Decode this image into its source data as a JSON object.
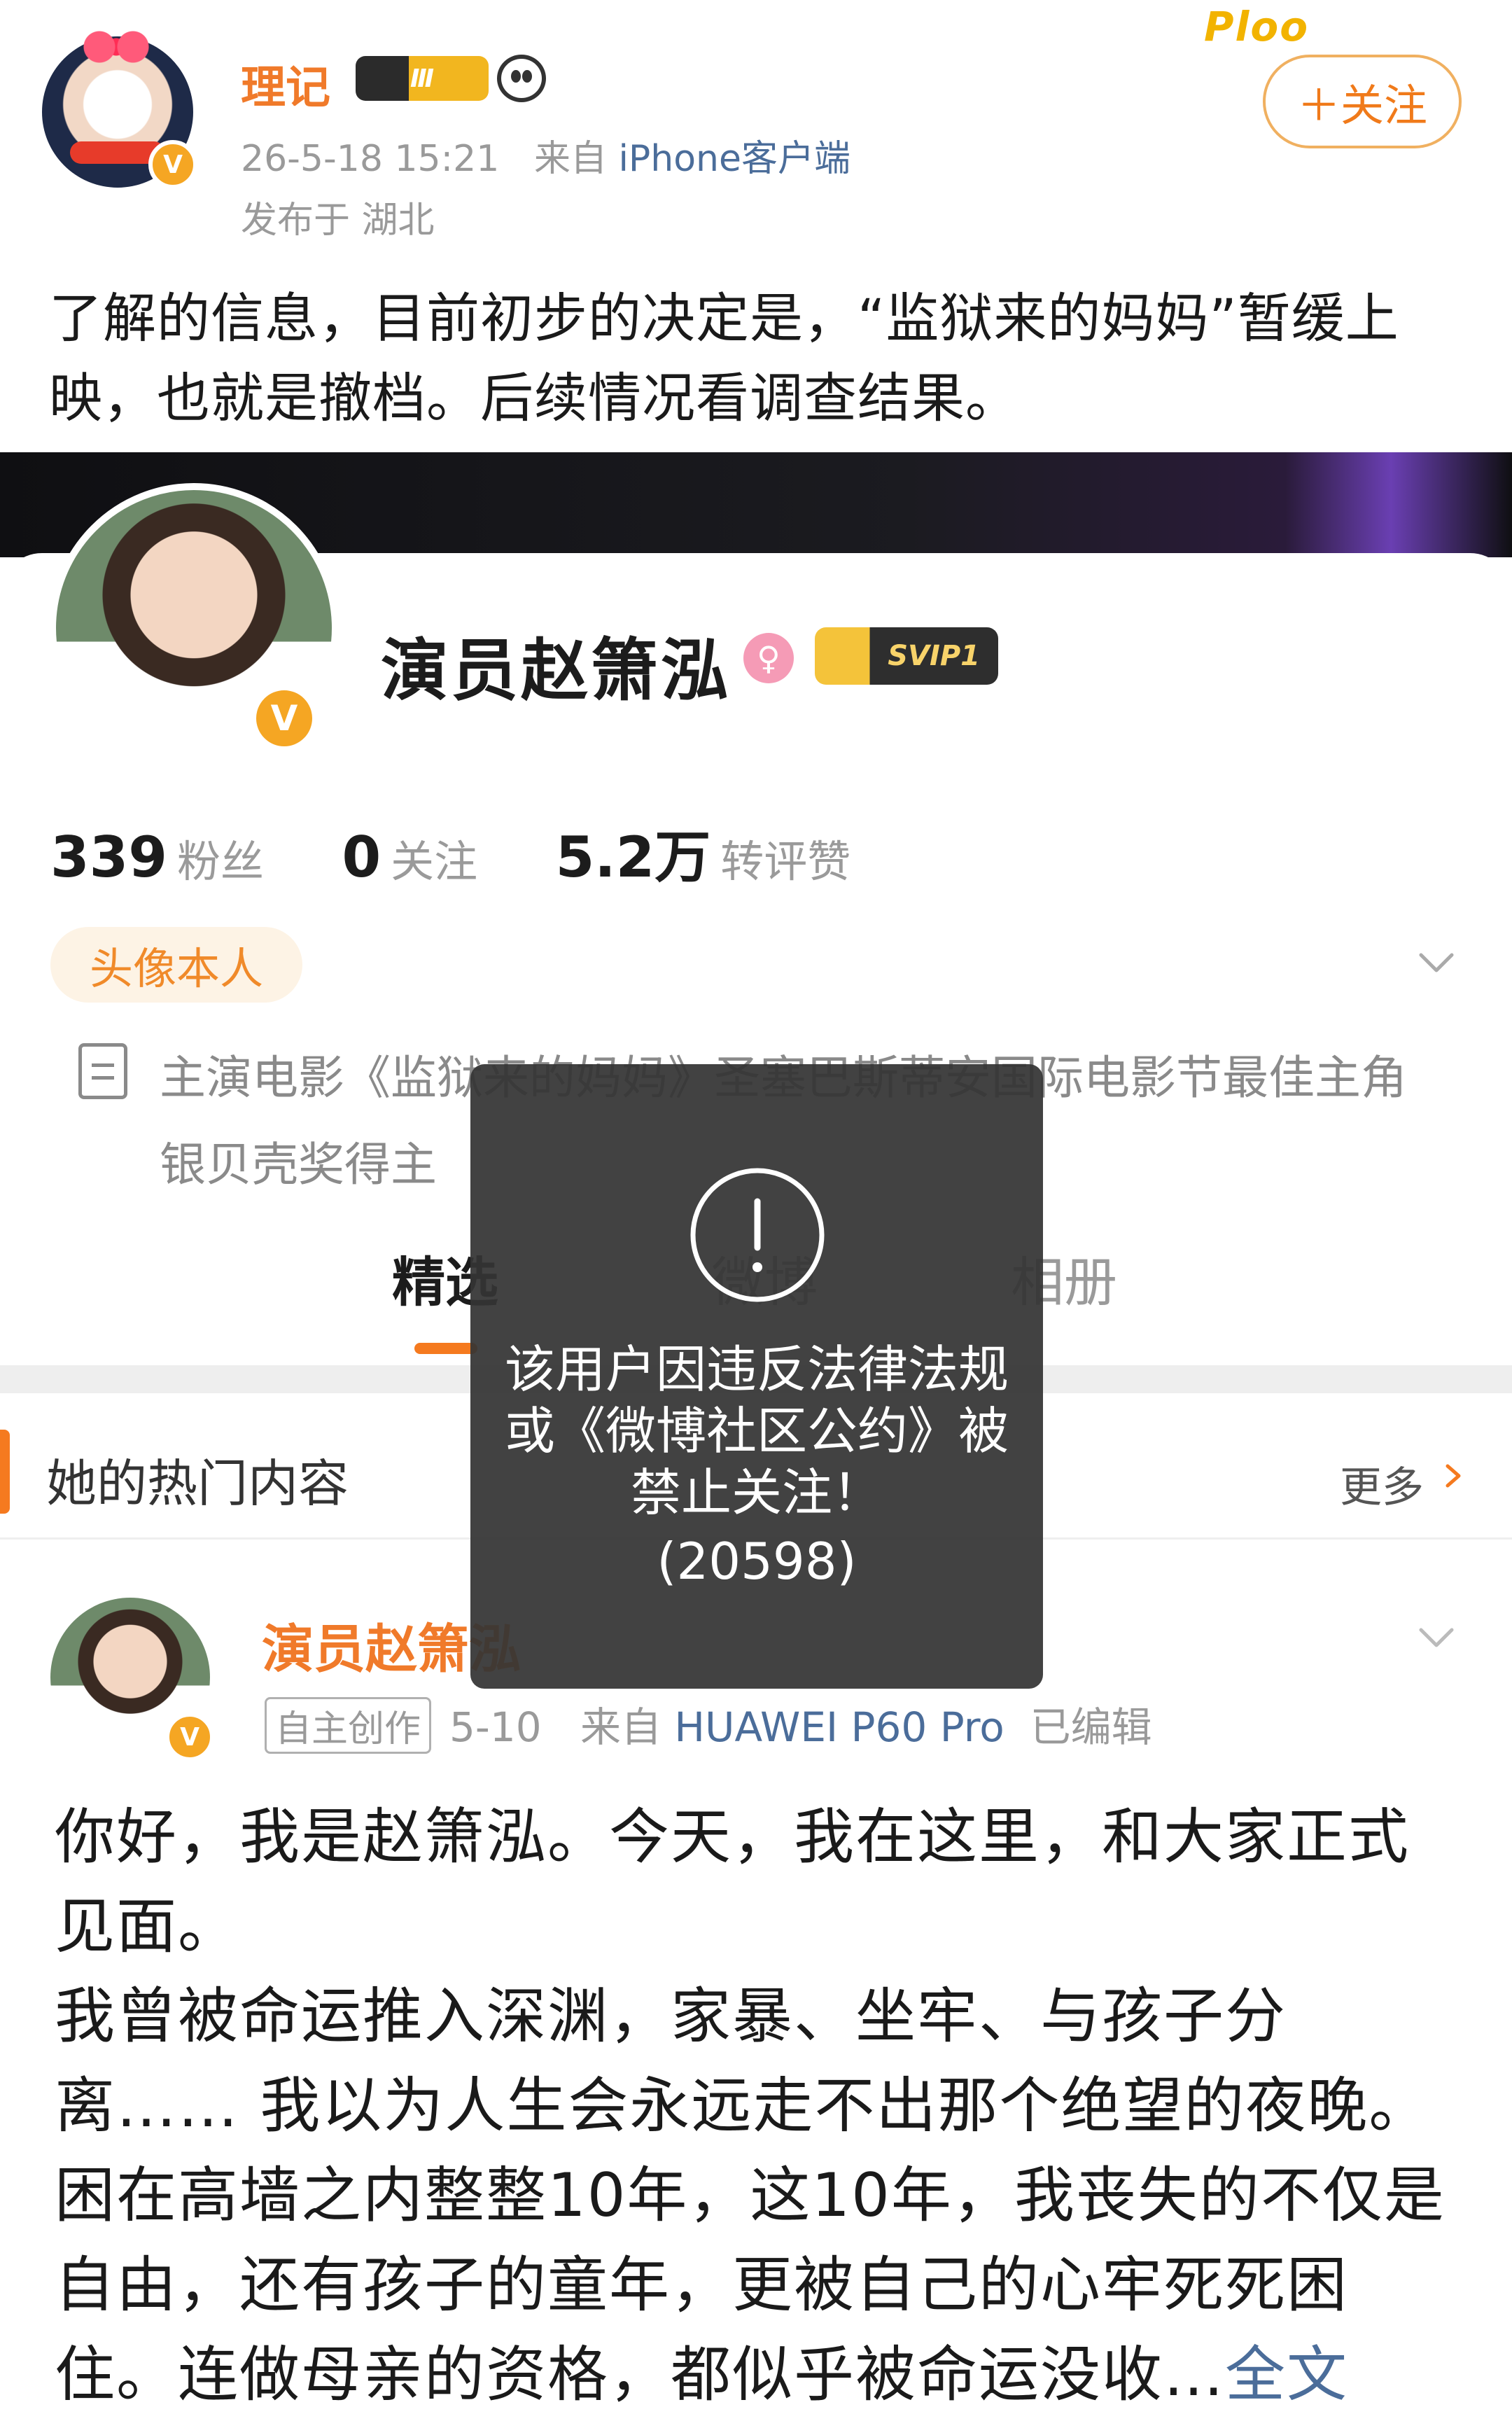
{
  "top_post": {
    "username": "理记",
    "level_badge": "Ⅲ",
    "timestamp": "26-5-18 15:21",
    "source_prefix": "来自",
    "source": "iPhone客户端",
    "location": "发布于 湖北",
    "follow_label": "＋关注",
    "sticker_text": "Ploo",
    "text": "了解的信息，目前初步的决定是，“监狱来的妈妈”暂缓上映，也就是撤档。后续情况看调查结果。"
  },
  "profile": {
    "name": "演员赵箫泓",
    "gender_icon": "female-icon",
    "svip": "SVIP1",
    "verified_mark": "V",
    "stats": [
      {
        "num": "339",
        "label": "粉丝"
      },
      {
        "num": "0",
        "label": "关注"
      },
      {
        "num": "5.2万",
        "label": "转评赞"
      }
    ],
    "tag": "头像本人",
    "intro": "主演电影《监狱来的妈妈》圣塞巴斯蒂安国际电影节最佳主角银贝壳奖得主"
  },
  "tabs": [
    {
      "label": "精选"
    },
    {
      "label": "微博"
    },
    {
      "label": "相册"
    }
  ],
  "hot": {
    "title": "她的热门内容",
    "more": "更多"
  },
  "post": {
    "author": "演员赵箫泓",
    "chip": "自主创作",
    "date": "5-10",
    "source_prefix": "来自",
    "source": "HUAWEI P60 Pro",
    "edited": "已编辑",
    "text": "你好，我是赵箫泓。今天，我在这里，和大家正式见面。\n我曾被命运推入深渊，家暴、坐牢、与孩子分离…… 我以为人生会永远走不出那个绝望的夜晚。困在高墙之内整整10年，这10年，我丧失的不仅是自由，还有孩子的童年，更被自己的心牢死死困住。连做母亲的资格，都似乎被命运没收…",
    "full_link": "全文"
  },
  "toast": {
    "message": "该用户因违反法律法规或《微博社区公约》被禁止关注！",
    "code": "(20598)"
  },
  "colors": {
    "accent": "#f57a1f",
    "username": "#f07a2a",
    "link": "#4b6d9a",
    "verified": "#f5a623"
  }
}
